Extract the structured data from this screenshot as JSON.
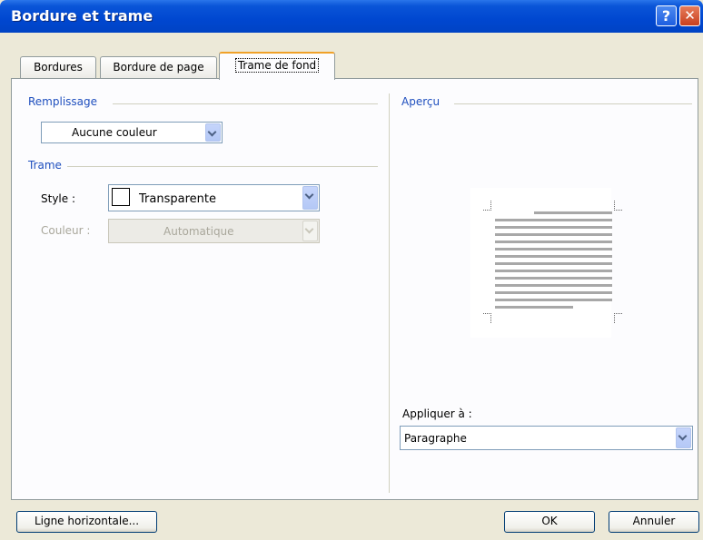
{
  "window": {
    "title": "Bordure et trame",
    "help_glyph": "?",
    "close_glyph": "✕"
  },
  "tabs": [
    {
      "label": "Bordures",
      "active": false
    },
    {
      "label": "Bordure de page",
      "active": false
    },
    {
      "label": "Trame de fond",
      "active": true
    }
  ],
  "fill": {
    "group_label": "Remplissage",
    "color_value": "Aucune couleur"
  },
  "pattern": {
    "group_label": "Trame",
    "style_label": "Style :",
    "style_value": "Transparente",
    "color_label": "Couleur :",
    "color_value": "Automatique"
  },
  "preview": {
    "group_label": "Aperçu"
  },
  "apply": {
    "label": "Appliquer à :",
    "value": "Paragraphe"
  },
  "buttons": {
    "horizontal_line": "Ligne horizontale...",
    "ok": "OK",
    "cancel": "Annuler"
  },
  "colors": {
    "title_bar": "#0047d0",
    "group_label": "#1f4fbe",
    "active_tab_accent": "#f0a128",
    "dialog_bg": "#ece9d8"
  }
}
